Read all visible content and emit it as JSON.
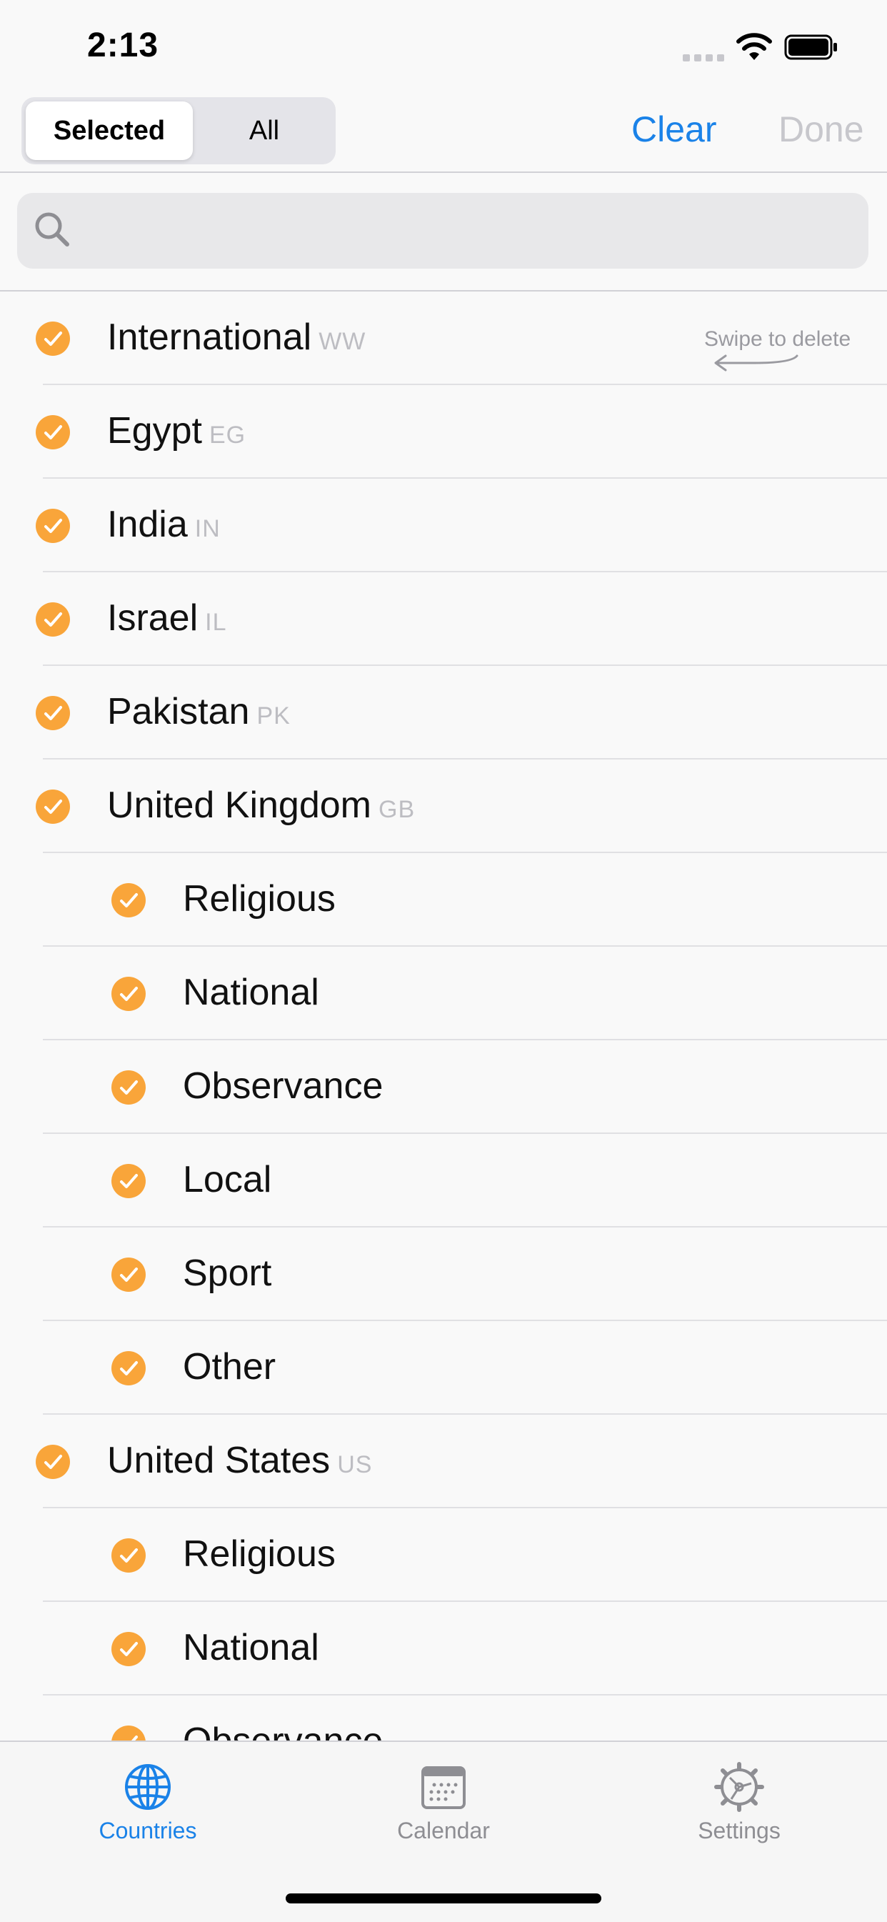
{
  "status_bar": {
    "time": "2:13"
  },
  "nav": {
    "segments": [
      "Selected",
      "All"
    ],
    "selected_segment": "Selected",
    "clear_label": "Clear",
    "done_label": "Done"
  },
  "search": {
    "placeholder": ""
  },
  "swipe_hint": "Swipe to delete",
  "list": [
    {
      "name": "International",
      "code": "WW",
      "checked": true,
      "level": 0
    },
    {
      "name": "Egypt",
      "code": "EG",
      "checked": true,
      "level": 0
    },
    {
      "name": "India",
      "code": "IN",
      "checked": true,
      "level": 0
    },
    {
      "name": "Israel",
      "code": "IL",
      "checked": true,
      "level": 0
    },
    {
      "name": "Pakistan",
      "code": "PK",
      "checked": true,
      "level": 0
    },
    {
      "name": "United Kingdom",
      "code": "GB",
      "checked": true,
      "level": 0
    },
    {
      "name": "Religious",
      "code": "",
      "checked": true,
      "level": 1
    },
    {
      "name": "National",
      "code": "",
      "checked": true,
      "level": 1
    },
    {
      "name": "Observance",
      "code": "",
      "checked": true,
      "level": 1
    },
    {
      "name": "Local",
      "code": "",
      "checked": true,
      "level": 1
    },
    {
      "name": "Sport",
      "code": "",
      "checked": true,
      "level": 1
    },
    {
      "name": "Other",
      "code": "",
      "checked": true,
      "level": 1
    },
    {
      "name": "United States",
      "code": "US",
      "checked": true,
      "level": 0
    },
    {
      "name": "Religious",
      "code": "",
      "checked": true,
      "level": 1
    },
    {
      "name": "National",
      "code": "",
      "checked": true,
      "level": 1
    },
    {
      "name": "Observance",
      "code": "",
      "checked": true,
      "level": 1
    }
  ],
  "tabs": [
    {
      "label": "Countries",
      "icon": "globe-icon",
      "active": true
    },
    {
      "label": "Calendar",
      "icon": "calendar-icon",
      "active": false
    },
    {
      "label": "Settings",
      "icon": "gear-icon",
      "active": false
    }
  ],
  "colors": {
    "accent": "#1a82e8",
    "check": "#f9a53a",
    "disabled": "#c7c7cc",
    "code_text": "#bdbdc2"
  }
}
